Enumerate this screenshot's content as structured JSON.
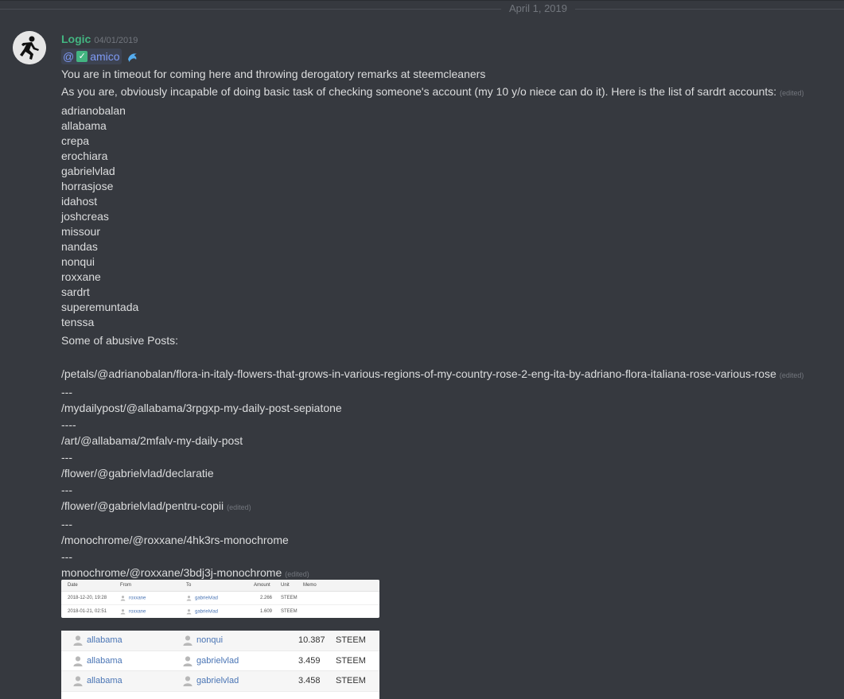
{
  "date_divider": "April 1, 2019",
  "message": {
    "author": "Logic",
    "timestamp": "04/01/2019",
    "mention": {
      "prefix": "@",
      "check": "✅",
      "name": "amico"
    },
    "line1": "You are in timeout for coming here and throwing derogatory remarks at steemcleaners",
    "line2": "As you are, obviously incapable of doing basic task of checking someone's account (my 10 y/o niece can do it). Here is the list of sardrt accounts:",
    "edited": "(edited)",
    "accounts": [
      "adrianobalan",
      "allabama",
      "crepa",
      "erochiara",
      "gabrielvlad",
      "horrasjose",
      "idahost",
      "joshcreas",
      "missour",
      "nandas",
      "nonqui",
      "roxxane",
      "sardrt",
      "superemuntada",
      "tenssa"
    ],
    "posts_heading": "Some of abusive Posts:",
    "posts": [
      {
        "text": "/petals/@adrianobalan/flora-in-italy-flowers-that-grows-in-various-regions-of-my-country-rose-2-eng-ita-by-adriano-flora-italiana-rose-various-rose",
        "edited": "(edited)"
      },
      {
        "text": "---",
        "edited": ""
      },
      {
        "text": "/mydailypost/@allabama/3rpgxp-my-daily-post-sepiatone",
        "edited": ""
      },
      {
        "text": "----",
        "edited": ""
      },
      {
        "text": "/art/@allabama/2mfalv-my-daily-post",
        "edited": ""
      },
      {
        "text": "---",
        "edited": ""
      },
      {
        "text": "/flower/@gabrielvlad/declaratie",
        "edited": ""
      },
      {
        "text": "---",
        "edited": ""
      },
      {
        "text": "/flower/@gabrielvlad/pentru-copii",
        "edited": "(edited)"
      },
      {
        "text": "---",
        "edited": ""
      },
      {
        "text": "/monochrome/@roxxane/4hk3rs-monochrome",
        "edited": ""
      },
      {
        "text": "---",
        "edited": ""
      },
      {
        "text": "monochrome/@roxxane/3bdj3j-monochrome",
        "edited": "(edited)"
      }
    ]
  },
  "embed1": {
    "headers": {
      "date": "Date",
      "from": "From",
      "to": "To",
      "amount": "Amount",
      "unit": "Unit",
      "memo": "Memo"
    },
    "rows": [
      {
        "date": "2018-12-20, 19:28",
        "from": "roxxane",
        "to": "gabrielvlad",
        "amount": "2.266",
        "unit": "STEEM"
      },
      {
        "date": "2018-01-21, 02:51",
        "from": "roxxane",
        "to": "gabrielvlad",
        "amount": "1.609",
        "unit": "STEEM"
      }
    ]
  },
  "embed2": {
    "rows": [
      {
        "from": "allabama",
        "to": "nonqui",
        "amount": "10.387",
        "unit": "STEEM"
      },
      {
        "from": "allabama",
        "to": "gabrielvlad",
        "amount": "3.459",
        "unit": "STEEM"
      },
      {
        "from": "allabama",
        "to": "gabrielvlad",
        "amount": "3.458",
        "unit": "STEEM"
      }
    ]
  },
  "colors": {
    "background": "#36393f",
    "author": "#43b581",
    "mention": "#7e9af5",
    "link": "#4a75b5"
  }
}
